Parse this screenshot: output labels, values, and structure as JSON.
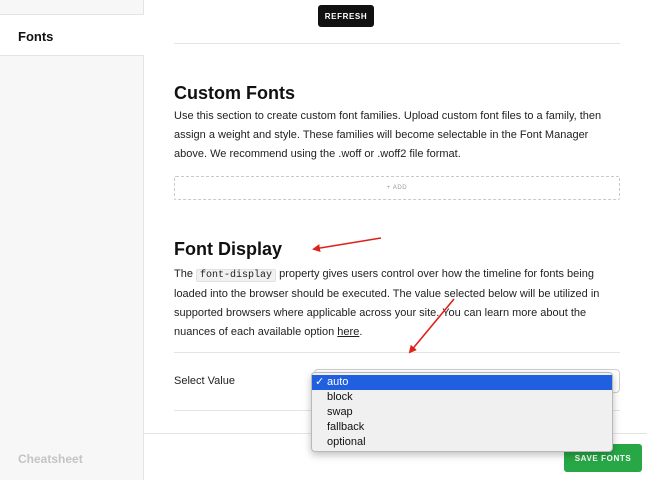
{
  "sidebar": {
    "active_item": "Fonts",
    "footer_item": "Cheatsheet"
  },
  "toolbar": {
    "refresh_label": "REFRESH"
  },
  "custom_fonts": {
    "title": "Custom Fonts",
    "description": "Use this section to create custom font families. Upload custom font files to a family, then assign a weight and style. These families will become selectable in the Font Manager above. We recommend using the .woff or .woff2 file format.",
    "add_label": "+ ADD"
  },
  "font_display": {
    "title": "Font Display",
    "text_before_code": "The ",
    "code": "font-display",
    "text_after_code": " property gives users control over how the timeline for fonts being loaded into the browser should be executed. The value selected below will be utilized in supported browsers where applicable across your site. You can learn more about the nuances of each available option ",
    "link_text": "here",
    "text_end": ".",
    "select_label": "Select Value",
    "options": [
      "auto",
      "block",
      "swap",
      "fallback",
      "optional"
    ],
    "selected": "auto"
  },
  "footer": {
    "save_label": "SAVE FONTS"
  },
  "colors": {
    "save_green": "#27a745",
    "selection_blue": "#1f5fe0",
    "annotation_red": "#e0201a"
  }
}
